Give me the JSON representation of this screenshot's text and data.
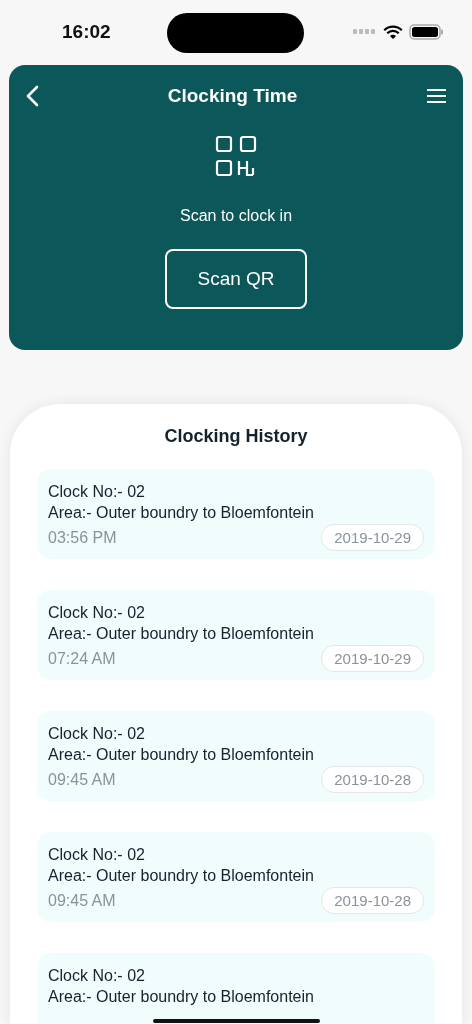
{
  "status_bar": {
    "time": "16:02"
  },
  "header": {
    "title": "Clocking Time",
    "prompt": "Scan to clock in",
    "button": "Scan QR"
  },
  "history": {
    "title": "Clocking History",
    "entries": [
      {
        "clock_no": "Clock No:-  02",
        "area": "Area:- Outer boundry to Bloemfontein",
        "time": "03:56 PM",
        "date": "2019-10-29"
      },
      {
        "clock_no": "Clock No:-  02",
        "area": "Area:- Outer boundry to Bloemfontein",
        "time": "07:24 AM",
        "date": "2019-10-29"
      },
      {
        "clock_no": "Clock No:-  02",
        "area": "Area:- Outer boundry to Bloemfontein",
        "time": "09:45 AM",
        "date": "2019-10-28"
      },
      {
        "clock_no": "Clock No:-  02",
        "area": "Area:- Outer boundry to Bloemfontein",
        "time": "09:45 AM",
        "date": "2019-10-28"
      },
      {
        "clock_no": "Clock No:-  02",
        "area": "Area:- Outer boundry to Bloemfontein"
      }
    ]
  }
}
